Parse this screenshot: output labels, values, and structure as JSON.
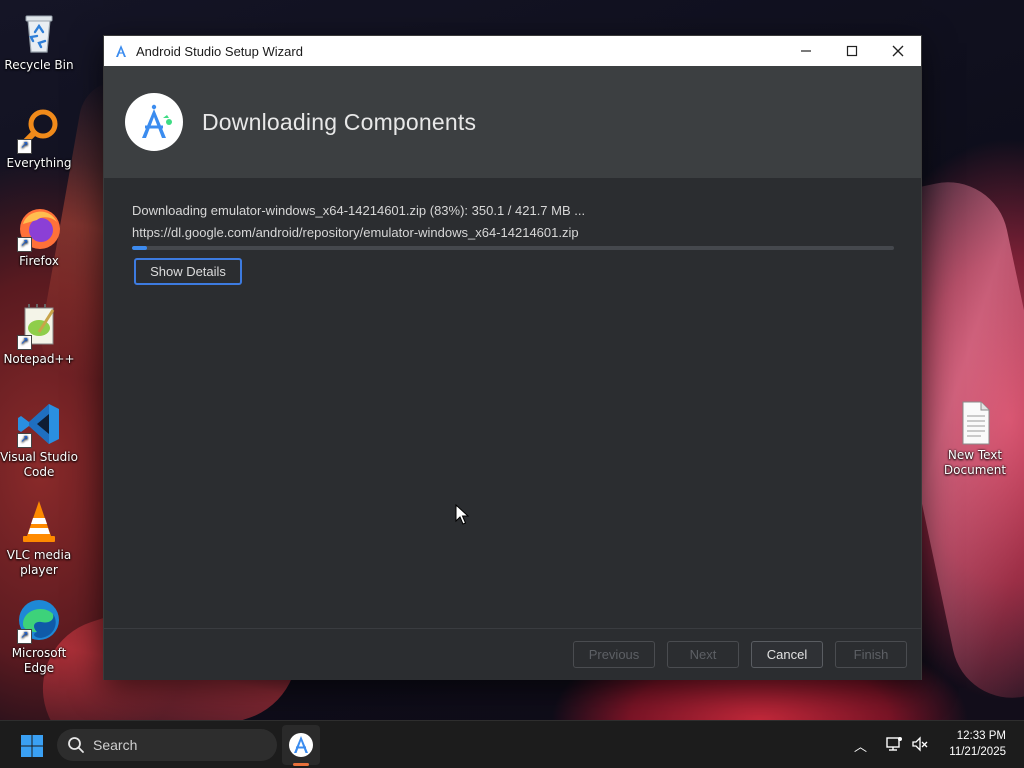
{
  "desktop": {
    "icons": [
      {
        "label": "Recycle Bin",
        "icon": "recycle-bin-icon"
      },
      {
        "label": "Everything",
        "icon": "everything-search-icon"
      },
      {
        "label": "Firefox",
        "icon": "firefox-icon"
      },
      {
        "label": "Notepad++",
        "icon": "notepad-plus-plus-icon"
      },
      {
        "label": "Visual Studio Code",
        "icon": "vscode-icon"
      },
      {
        "label": "VLC media player",
        "icon": "vlc-icon"
      },
      {
        "label": "Microsoft Edge",
        "icon": "edge-icon"
      },
      {
        "label": "New Text Document",
        "icon": "text-document-icon"
      }
    ]
  },
  "window": {
    "title": "Android Studio Setup Wizard",
    "controls": {
      "minimize": "minimize-icon",
      "maximize": "maximize-icon",
      "close": "close-icon"
    },
    "header": {
      "title": "Downloading Components",
      "logo": "android-studio-logo-icon"
    },
    "content": {
      "status_line": "Downloading emulator-windows_x64-14214601.zip (83%): 350.1 / 421.7 MB ...",
      "url_line": "https://dl.google.com/android/repository/emulator-windows_x64-14214601.zip",
      "progress_fraction": 0.02,
      "show_details_label": "Show Details"
    },
    "footer": {
      "previous_label": "Previous",
      "next_label": "Next",
      "cancel_label": "Cancel",
      "finish_label": "Finish"
    }
  },
  "taskbar": {
    "search_placeholder": "Search",
    "pinned_app": "android-studio-icon",
    "time": "12:33 PM",
    "date": "11/21/2025"
  },
  "colors": {
    "accent": "#3d8bef",
    "window_bg": "#2b2d30",
    "header_bg": "#3c3f41",
    "taskbar_bg": "#1c1c1c"
  }
}
